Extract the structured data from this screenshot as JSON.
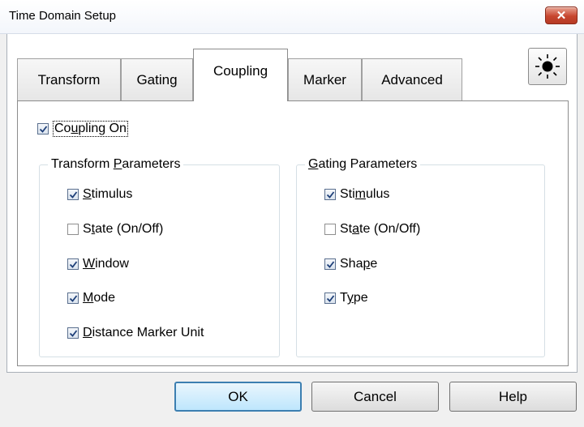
{
  "window": {
    "title": "Time Domain Setup"
  },
  "tabs": [
    {
      "label": "Transform"
    },
    {
      "label": "Gating"
    },
    {
      "label": "Coupling",
      "active": true
    },
    {
      "label": "Marker"
    },
    {
      "label": "Advanced"
    }
  ],
  "coupling": {
    "pre": "Co",
    "mn": "u",
    "post": "pling On",
    "checked": true
  },
  "transform_params": {
    "title_pre": "Transform ",
    "title_mn": "P",
    "title_post": "arameters",
    "items": [
      {
        "pre": "",
        "mn": "S",
        "post": "timulus",
        "checked": true
      },
      {
        "pre": "S",
        "mn": "t",
        "post": "ate (On/Off)",
        "checked": false
      },
      {
        "pre": "",
        "mn": "W",
        "post": "indow",
        "checked": true
      },
      {
        "pre": "",
        "mn": "M",
        "post": "ode",
        "checked": true
      },
      {
        "pre": "",
        "mn": "D",
        "post": "istance Marker Unit",
        "checked": true
      }
    ]
  },
  "gating_params": {
    "title_pre": "",
    "title_mn": "G",
    "title_post": "ating Parameters",
    "items": [
      {
        "pre": "Sti",
        "mn": "m",
        "post": "ulus",
        "checked": true
      },
      {
        "pre": "St",
        "mn": "a",
        "post": "te (On/Off)",
        "checked": false
      },
      {
        "pre": "Sha",
        "mn": "p",
        "post": "e",
        "checked": true
      },
      {
        "pre": "T",
        "mn": "y",
        "post": "pe",
        "checked": true
      }
    ]
  },
  "buttons": {
    "ok": "OK",
    "cancel": "Cancel",
    "help": "Help"
  },
  "icons": {
    "close": "close-icon",
    "light": "sun-icon"
  },
  "colors": {
    "close_red": "#c7462f",
    "default_button_border": "#3c7fb1",
    "checkbox_check": "#1e3f78"
  }
}
